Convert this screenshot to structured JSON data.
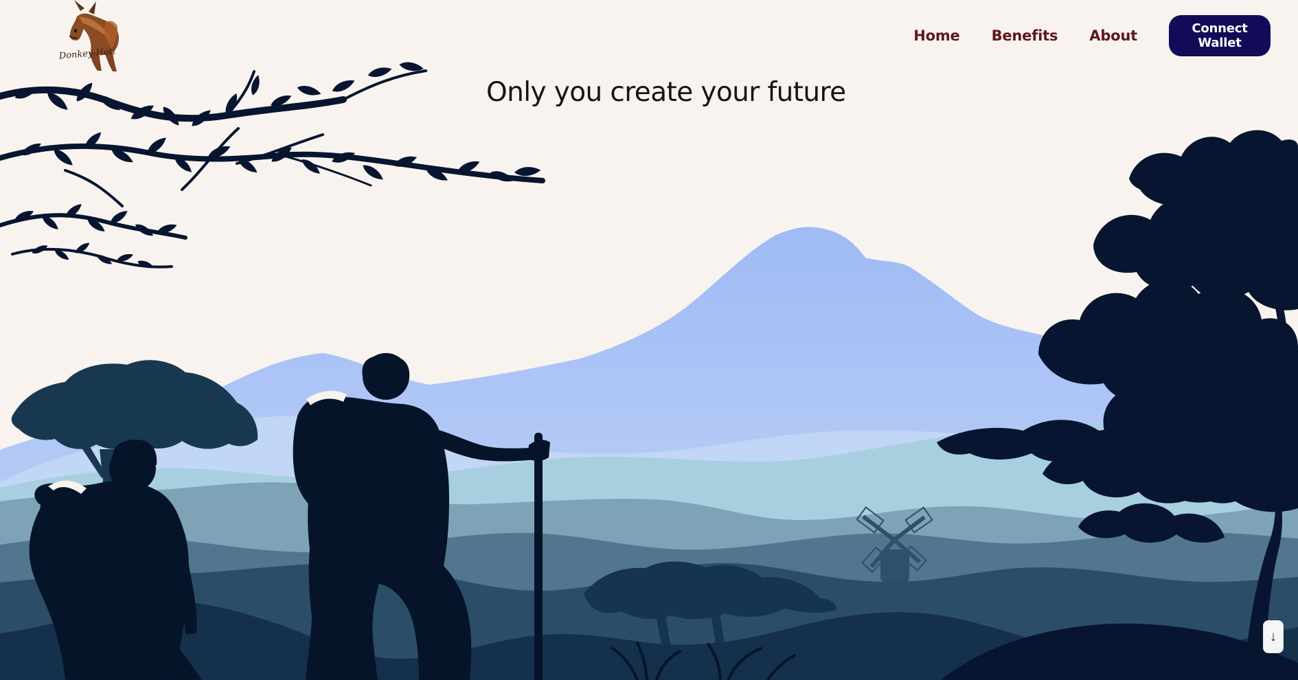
{
  "logo": {
    "label": "Donkey-Hoti"
  },
  "nav": {
    "items": [
      {
        "label": "Home"
      },
      {
        "label": "Benefits"
      },
      {
        "label": "About"
      }
    ],
    "connect_label": "Connect Wallet"
  },
  "hero": {
    "title": "Only you create your future"
  },
  "controls": {
    "scroll_down": "↓"
  },
  "icons": {
    "logo": "donkey-logo",
    "scroll_down": "arrow-down-icon"
  },
  "colors": {
    "background": "#f8f3ee",
    "nav_link": "#5f1720",
    "connect_button": "#120b58",
    "silhouette": "#06142a",
    "mountain_far": "#a2bdf5",
    "hill_light": "#a8cfdf",
    "hill_mid": "#6f95ad",
    "hill_dark": "#294a64"
  }
}
